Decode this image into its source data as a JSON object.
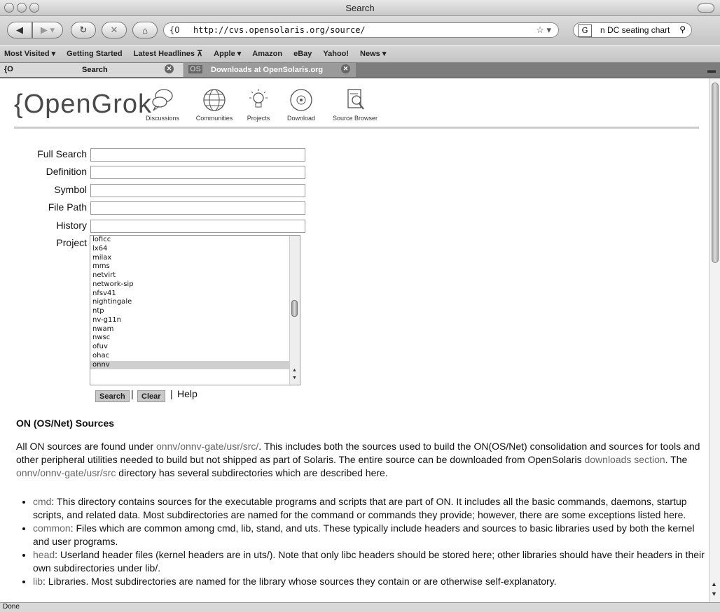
{
  "window": {
    "title": "Search"
  },
  "toolbar": {
    "url_favicon": "{O",
    "url": "http://cvs.opensolaris.org/source/",
    "search_text": "n DC seating chart",
    "search_engine_badge": "G"
  },
  "bookmarks": [
    "Most Visited ▾",
    "Getting Started",
    "Latest Headlines ⊼",
    "Apple ▾",
    "Amazon",
    "eBay",
    "Yahoo!",
    "News ▾"
  ],
  "tabs": [
    {
      "icon": "{O",
      "label": "Search"
    },
    {
      "icon": "OS",
      "label": "Downloads at OpenSolaris.org"
    }
  ],
  "page": {
    "logo": "{OpenGrok",
    "nav": [
      "Discussions",
      "Communities",
      "Projects",
      "Download",
      "Source Browser"
    ],
    "form": {
      "labels": [
        "Full Search",
        "Definition",
        "Symbol",
        "File Path",
        "History",
        "Project"
      ],
      "projects": [
        "loficc",
        "lx64",
        "milax",
        "mms",
        "netvirt",
        "network-sip",
        "nfsv41",
        "nightingale",
        "ntp",
        "nv-g11n",
        "nwam",
        "nwsc",
        "ofuv",
        "ohac",
        "onnv"
      ],
      "selected_project": "onnv",
      "search_button": "Search",
      "clear_button": "Clear",
      "help": "Help"
    },
    "heading": "ON (OS/Net) Sources",
    "intro": {
      "t1": "All ON sources are found under ",
      "l1": "onnv/onnv-gate/usr/src/",
      "t2": ". This includes both the sources used to build the ON(OS/Net) consolidation and sources for tools and other peripheral utilities needed to build but not shipped as part of Solaris. The entire source can be downloaded from OpenSolaris ",
      "l2": "downloads section",
      "t3": ". The ",
      "l3": "onnv/onnv-gate/usr/src",
      "t4": " directory has several subdirectories which are described here."
    },
    "dirs": [
      {
        "name": "cmd",
        "desc": ": This directory contains sources for the executable programs and scripts that are part of ON. It includes all the basic commands, daemons, startup scripts, and related data. Most subdirectories are named for the command or commands they provide; however, there are some exceptions listed here."
      },
      {
        "name": "common",
        "desc": ": Files which are common among cmd, lib, stand, and uts. These typically include headers and sources to basic libraries used by both the kernel and user programs."
      },
      {
        "name": "head",
        "desc": ": Userland header files (kernel headers are in uts/). Note that only libc headers should be stored here; other libraries should have their headers in their own subdirectories under lib/."
      },
      {
        "name": "lib",
        "desc": ": Libraries. Most subdirectories are named for the library whose sources they contain or are otherwise self-explanatory."
      }
    ]
  },
  "status": "Done"
}
